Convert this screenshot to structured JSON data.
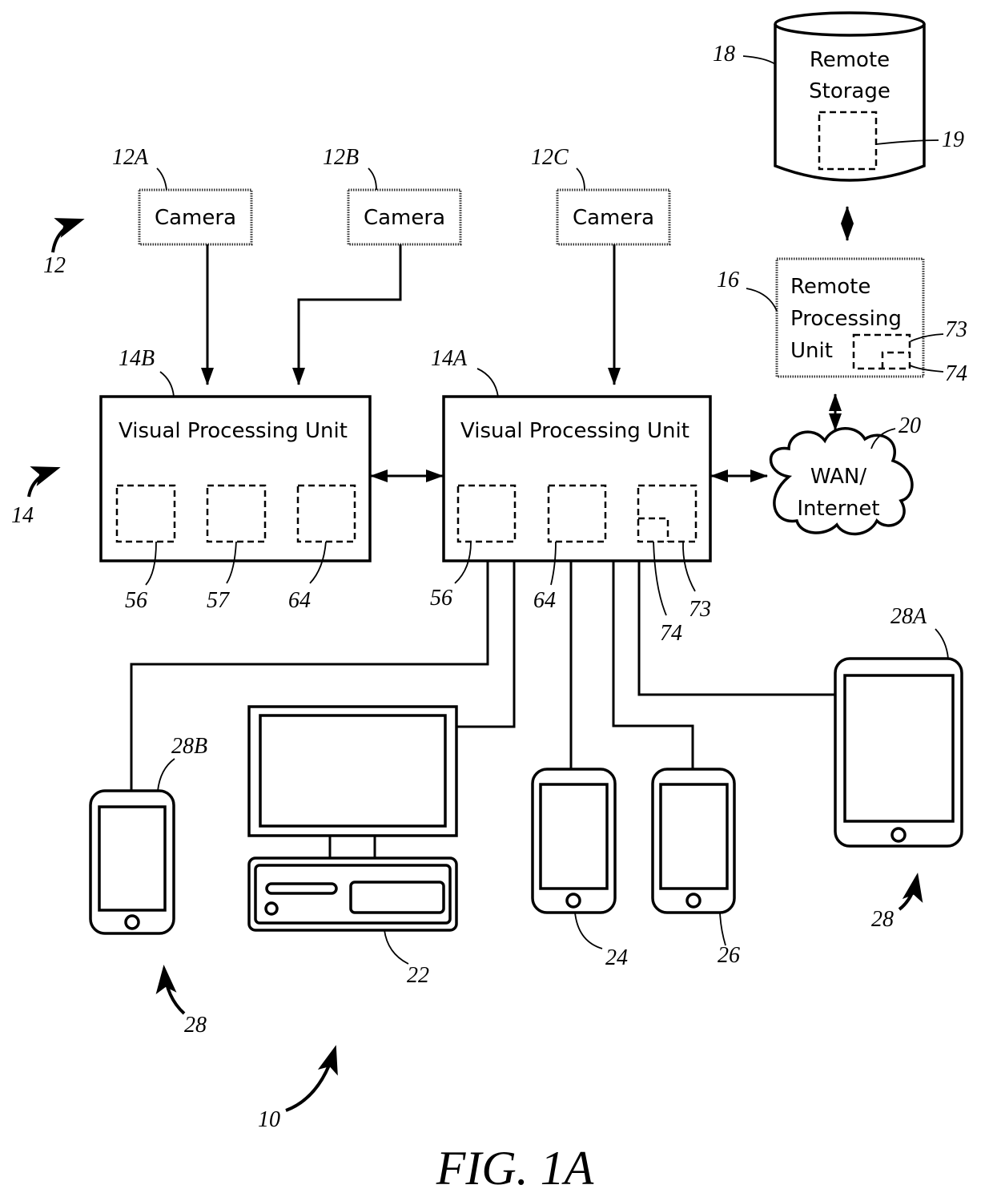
{
  "figure": {
    "title": "FIG. 1A",
    "system_ref": "10"
  },
  "cameras": {
    "group_ref": "12",
    "items": [
      {
        "ref": "12A",
        "label": "Camera"
      },
      {
        "ref": "12B",
        "label": "Camera"
      },
      {
        "ref": "12C",
        "label": "Camera"
      }
    ]
  },
  "vpus": {
    "group_ref": "14",
    "vpu_b": {
      "ref": "14B",
      "label": "Visual Processing Unit",
      "modules": [
        "56",
        "57",
        "64"
      ]
    },
    "vpu_a": {
      "ref": "14A",
      "label": "Visual Processing Unit",
      "modules": [
        "56",
        "64",
        "73"
      ],
      "submodule": "74"
    }
  },
  "remote_storage": {
    "ref": "18",
    "line1": "Remote",
    "line2": "Storage",
    "module": "19"
  },
  "remote_processing": {
    "ref": "16",
    "line1": "Remote",
    "line2": "Processing",
    "line3": "Unit",
    "module": "73",
    "submodule": "74"
  },
  "network": {
    "ref": "20",
    "line1": "WAN/",
    "line2": "Internet"
  },
  "devices": {
    "group_ref": "28",
    "group_ref_2": "28",
    "desktop": {
      "ref": "22"
    },
    "phone_1": {
      "ref": "24"
    },
    "phone_2": {
      "ref": "26"
    },
    "tablet": {
      "ref": "28A"
    },
    "phone_b": {
      "ref": "28B"
    }
  }
}
